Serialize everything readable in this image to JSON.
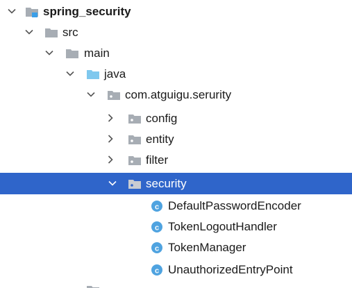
{
  "colors": {
    "selection_bg": "#2f65ca",
    "folder_gray": "#a7adb4",
    "folder_blue": "#7fc8ee",
    "module_accent": "#3b9fe8",
    "class_badge": "#4fa3e0"
  },
  "tree": {
    "items": [
      {
        "label": "spring_security",
        "icon": "module-folder-icon",
        "expanded": true,
        "bold": true
      },
      {
        "label": "src",
        "icon": "folder-icon",
        "expanded": true
      },
      {
        "label": "main",
        "icon": "folder-icon",
        "expanded": true
      },
      {
        "label": "java",
        "icon": "source-root-folder-icon",
        "expanded": true
      },
      {
        "label": "com.atguigu.serurity",
        "icon": "package-icon",
        "expanded": true
      },
      {
        "label": "config",
        "icon": "package-icon",
        "expanded": false
      },
      {
        "label": "entity",
        "icon": "package-icon",
        "expanded": false
      },
      {
        "label": "filter",
        "icon": "package-icon",
        "expanded": false
      },
      {
        "label": "security",
        "icon": "package-icon",
        "expanded": true,
        "selected": true
      },
      {
        "label": "DefaultPasswordEncoder",
        "icon": "class-icon"
      },
      {
        "label": "TokenLogoutHandler",
        "icon": "class-icon"
      },
      {
        "label": "TokenManager",
        "icon": "class-icon"
      },
      {
        "label": "UnauthorizedEntryPoint",
        "icon": "class-icon"
      }
    ]
  }
}
